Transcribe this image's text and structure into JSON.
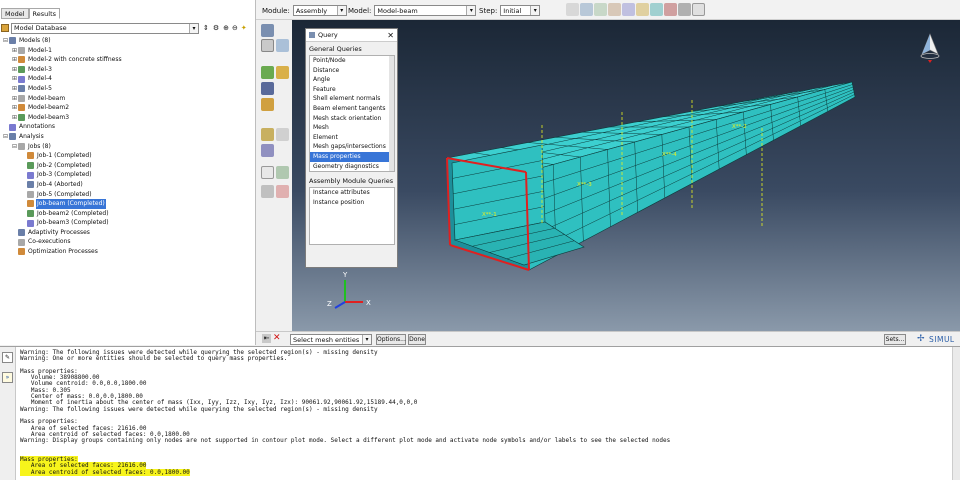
{
  "left_panel": {
    "tabs": [
      "Model",
      "Results"
    ],
    "database_select": "Model Database",
    "tree": [
      {
        "label": "Models (8)",
        "level": 0,
        "expander": "⊟"
      },
      {
        "label": "Model-1",
        "level": 1,
        "expander": "⊞"
      },
      {
        "label": "Model-2 with concrete stiffness",
        "level": 1,
        "expander": "⊞"
      },
      {
        "label": "Model-3",
        "level": 1,
        "expander": "⊞"
      },
      {
        "label": "Model-4",
        "level": 1,
        "expander": "⊞"
      },
      {
        "label": "Model-5",
        "level": 1,
        "expander": "⊞"
      },
      {
        "label": "Model-beam",
        "level": 1,
        "expander": "⊞"
      },
      {
        "label": "Model-beam2",
        "level": 1,
        "expander": "⊞"
      },
      {
        "label": "Model-beam3",
        "level": 1,
        "expander": "⊞"
      },
      {
        "label": "Annotations",
        "level": 0,
        "expander": ""
      },
      {
        "label": "Analysis",
        "level": 0,
        "expander": "⊟"
      },
      {
        "label": "Jobs (8)",
        "level": 1,
        "expander": "⊟"
      },
      {
        "label": "Job-1 (Completed)",
        "level": 2,
        "expander": ""
      },
      {
        "label": "Job-2 (Completed)",
        "level": 2,
        "expander": ""
      },
      {
        "label": "Job-3 (Completed)",
        "level": 2,
        "expander": ""
      },
      {
        "label": "Job-4 (Aborted)",
        "level": 2,
        "expander": ""
      },
      {
        "label": "Job-5 (Completed)",
        "level": 2,
        "expander": ""
      },
      {
        "label": "Job-beam (Completed)",
        "level": 2,
        "expander": "",
        "selected": true
      },
      {
        "label": "Job-beam2 (Completed)",
        "level": 2,
        "expander": ""
      },
      {
        "label": "Job-beam3 (Completed)",
        "level": 2,
        "expander": ""
      },
      {
        "label": "Adaptivity Processes",
        "level": 1,
        "expander": ""
      },
      {
        "label": "Co-executions",
        "level": 1,
        "expander": ""
      },
      {
        "label": "Optimization Processes",
        "level": 1,
        "expander": ""
      }
    ]
  },
  "context_bar": {
    "module_label": "Module:",
    "module_value": "Assembly",
    "model_label": "Model:",
    "model_value": "Model-beam",
    "step_label": "Step:",
    "step_value": "Initial"
  },
  "query_dialog": {
    "title": "Query",
    "general_heading": "General Queries",
    "general_items": [
      "Point/Node",
      "Distance",
      "Angle",
      "Feature",
      "Shell element normals",
      "Beam element tangents",
      "Mesh stack orientation",
      "Mesh",
      "Element",
      "Mesh gaps/intersections",
      "Mass properties",
      "Geometry diagnostics"
    ],
    "selected_item": "Mass properties",
    "module_heading": "Assembly Module Queries",
    "module_items": [
      "Instance attributes",
      "Instance position"
    ]
  },
  "prompt_bar": {
    "select_value": "Select mesh entities",
    "options_label": "Options...",
    "done_label": "Done",
    "sets_label": "Sets..."
  },
  "brand": "SIMUL",
  "triad": {
    "x": "X",
    "y": "Y",
    "z": "Z"
  },
  "beam_labels": [
    "X**-1",
    "X**-3",
    "X**-4",
    "X**-2"
  ],
  "messages": [
    {
      "text": "Warning: The following issues were detected while querying the selected region(s) - missing density",
      "highlight": false
    },
    {
      "text": "Warning: One or more entities should be selected to query mass properties.",
      "highlight": false
    },
    {
      "text": "",
      "highlight": false
    },
    {
      "text": "Mass properties:",
      "highlight": false
    },
    {
      "text": "   Volume: 38908800.00",
      "highlight": false
    },
    {
      "text": "   Volume centroid: 0.0,0.0,1800.00",
      "highlight": false
    },
    {
      "text": "   Mass: 0.305",
      "highlight": false
    },
    {
      "text": "   Center of mass: 0.0,0.0,1800.00",
      "highlight": false
    },
    {
      "text": "   Moment of inertia about the center of mass (Ixx, Iyy, Izz, Ixy, Iyz, Izx): 90061.92,90061.92,15189.44,0,0,0",
      "highlight": false
    },
    {
      "text": "Warning: The following issues were detected while querying the selected region(s) - missing density",
      "highlight": false
    },
    {
      "text": "",
      "highlight": false
    },
    {
      "text": "Mass properties:",
      "highlight": false
    },
    {
      "text": "   Area of selected faces: 21616.00",
      "highlight": false
    },
    {
      "text": "   Area centroid of selected faces: 0.0,1800.00",
      "highlight": false
    },
    {
      "text": "Warning: Display groups containing only nodes are not supported in contour plot mode. Select a different plot mode and activate node symbols and/or labels to see the selected nodes",
      "highlight": false
    },
    {
      "text": "",
      "highlight": false
    },
    {
      "text": "",
      "highlight": false
    },
    {
      "text": "Mass properties:",
      "highlight": true
    },
    {
      "text": "   Area of selected faces: 21616.00",
      "highlight": true
    },
    {
      "text": "   Area centroid of selected faces: 0.0,1800.00",
      "highlight": true
    }
  ],
  "colors": {
    "mesh_face": "#2fc0c0",
    "mesh_top": "#3ccfcf",
    "mesh_line": "#0c3a3a",
    "selected_edge": "#e02020",
    "label_yellow": "#e8f020",
    "highlight": "#f7f41c",
    "selection_blue": "#3875d7"
  }
}
